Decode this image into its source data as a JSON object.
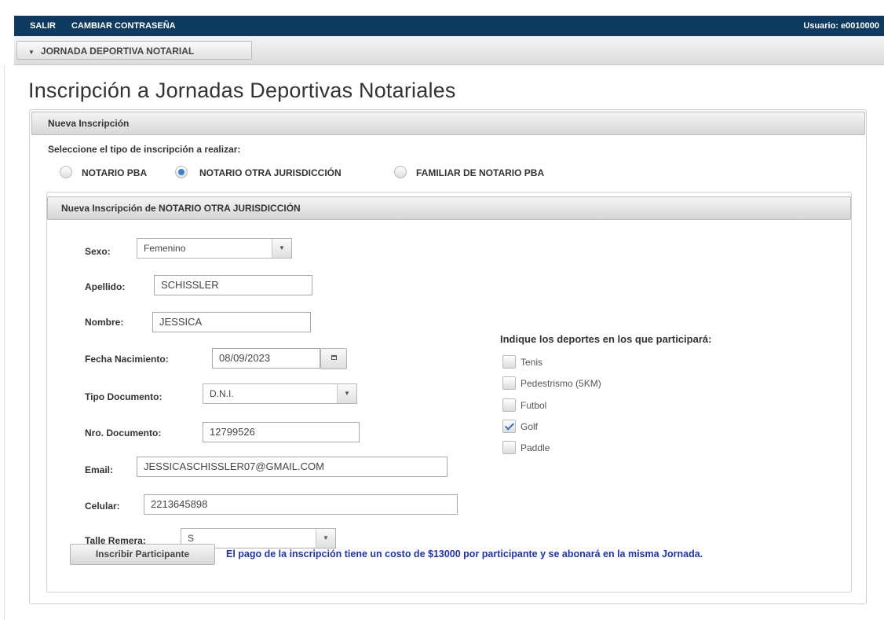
{
  "topbar": {
    "logout": "SALIR",
    "change_password": "CAMBIAR CONTRASEÑA",
    "user": "Usuario: e0010000"
  },
  "menu": {
    "section": "JORNADA DEPORTIVA NOTARIAL"
  },
  "page": {
    "title": "Inscripción a Jornadas Deportivas Notariales"
  },
  "panel": {
    "header": "Nueva Inscripción",
    "select_label": "Seleccione el tipo de inscripción a realizar:",
    "types": [
      {
        "label": "NOTARIO PBA",
        "selected": false
      },
      {
        "label": "NOTARIO OTRA JURISDICCIÓN",
        "selected": true
      },
      {
        "label": "FAMILIAR DE NOTARIO PBA",
        "selected": false
      }
    ]
  },
  "form": {
    "header": "Nueva Inscripción de NOTARIO OTRA JURISDICCIÓN",
    "sexo": {
      "label": "Sexo:",
      "value": "Femenino"
    },
    "apellido": {
      "label": "Apellido:",
      "value": "SCHISSLER"
    },
    "nombre": {
      "label": "Nombre:",
      "value": "JESSICA"
    },
    "fecha": {
      "label": "Fecha Nacimiento:",
      "value": "08/09/2023"
    },
    "tipo_doc": {
      "label": "Tipo Documento:",
      "value": "D.N.I."
    },
    "nro_doc": {
      "label": "Nro. Documento:",
      "value": "12799526"
    },
    "email": {
      "label": "Email:",
      "value": "JESSICASCHISSLER07@GMAIL.COM"
    },
    "celular": {
      "label": "Celular:",
      "value": "2213645898"
    },
    "talle": {
      "label": "Talle Remera:",
      "value": "S"
    },
    "submit": "Inscribir Participante",
    "notice": "El pago de la inscripción tiene un costo de $13000 por participante y se abonará en la misma Jornada."
  },
  "sports": {
    "title": "Indique los deportes en los que participará:",
    "items": [
      {
        "label": "Tenis",
        "checked": false
      },
      {
        "label": "Pedestrismo (5KM)",
        "checked": false
      },
      {
        "label": "Futbol",
        "checked": false
      },
      {
        "label": "Golf",
        "checked": true
      },
      {
        "label": "Paddle",
        "checked": false
      }
    ]
  },
  "colors": {
    "topbar": "#0d3a5e",
    "notice": "#2233aa",
    "accent": "#3a7fd0"
  },
  "icons": {
    "menu": "caret-down-icon",
    "calendar": "calendar-icon",
    "select": "chevron-down-icon"
  }
}
